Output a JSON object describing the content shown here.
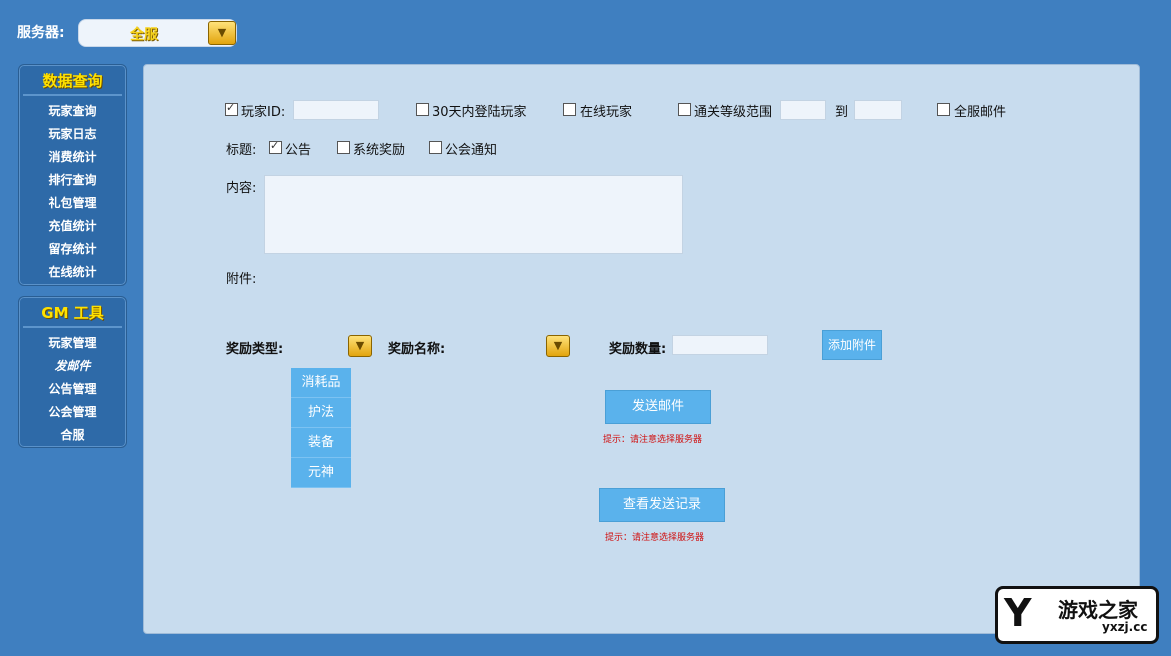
{
  "header": {
    "server_label": "服务器:",
    "server_value": "全服"
  },
  "sidebar": {
    "query_title": "数据查询",
    "query_items": [
      "玩家查询",
      "玩家日志",
      "消费统计",
      "排行查询",
      "礼包管理",
      "充值统计",
      "留存统计",
      "在线统计"
    ],
    "gm_title": "GM 工具",
    "gm_items": [
      "玩家管理",
      "发邮件",
      "公告管理",
      "公会管理",
      "合服"
    ]
  },
  "form": {
    "player_id_label": "玩家ID:",
    "login30_label": "30天内登陆玩家",
    "online_label": "在线玩家",
    "level_range_label": "通关等级范围",
    "to_label": "到",
    "all_server_mail_label": "全服邮件",
    "title_label": "标题:",
    "title_options": [
      "公告",
      "系统奖励",
      "公会通知"
    ],
    "content_label": "内容:",
    "attachment_label": "附件:",
    "reward_type_label": "奖励类型:",
    "reward_name_label": "奖励名称:",
    "reward_count_label": "奖励数量:",
    "add_attachment_button": "添加附件",
    "reward_type_options": [
      "消耗品",
      "护法",
      "装备",
      "元神"
    ],
    "send_mail_button": "发送邮件",
    "send_hint": "提示：请注意选择服务器",
    "view_record_button": "查看发送记录",
    "view_hint": "提示：请注意选择服务器"
  },
  "logo": {
    "mark": "Y",
    "name": "游戏之家",
    "url": "yxzj.cc"
  },
  "colors": {
    "background": "#3f7fc0",
    "panel": "#c8dcee",
    "accent_button": "#5ab2ec",
    "title_yellow": "#ffe100",
    "hint_red": "#d01010"
  }
}
